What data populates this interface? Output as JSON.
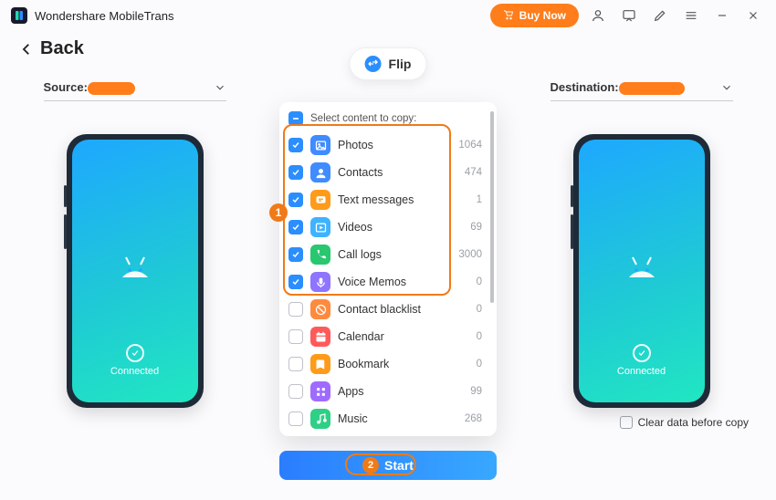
{
  "app": {
    "title": "Wondershare MobileTrans"
  },
  "titlebar": {
    "buy": "Buy Now"
  },
  "nav": {
    "back": "Back"
  },
  "flip": {
    "label": "Flip"
  },
  "source": {
    "label": "Source:"
  },
  "destination": {
    "label": "Destination:"
  },
  "phone": {
    "status": "Connected"
  },
  "panel": {
    "header": "Select content to copy:"
  },
  "items": [
    {
      "name": "Photos",
      "count": "1064",
      "checked": true,
      "iconBg": "#3f8bff",
      "glyph": "photo"
    },
    {
      "name": "Contacts",
      "count": "474",
      "checked": true,
      "iconBg": "#3f8bff",
      "glyph": "person"
    },
    {
      "name": "Text messages",
      "count": "1",
      "checked": true,
      "iconBg": "#ff9b1a",
      "glyph": "msg"
    },
    {
      "name": "Videos",
      "count": "69",
      "checked": true,
      "iconBg": "#3fb3ff",
      "glyph": "play"
    },
    {
      "name": "Call logs",
      "count": "3000",
      "checked": true,
      "iconBg": "#29c76f",
      "glyph": "phone"
    },
    {
      "name": "Voice Memos",
      "count": "0",
      "checked": true,
      "iconBg": "#8f74ff",
      "glyph": "mic"
    },
    {
      "name": "Contact blacklist",
      "count": "0",
      "checked": false,
      "iconBg": "#ff8a3d",
      "glyph": "block"
    },
    {
      "name": "Calendar",
      "count": "0",
      "checked": false,
      "iconBg": "#ff5a5a",
      "glyph": "cal"
    },
    {
      "name": "Bookmark",
      "count": "0",
      "checked": false,
      "iconBg": "#ff9b1a",
      "glyph": "book"
    },
    {
      "name": "Apps",
      "count": "99",
      "checked": false,
      "iconBg": "#9f6bff",
      "glyph": "grid"
    },
    {
      "name": "Music",
      "count": "268",
      "checked": false,
      "iconBg": "#2ecf86",
      "glyph": "music"
    }
  ],
  "start": {
    "label": "Start"
  },
  "clear": {
    "label": "Clear data before copy"
  },
  "steps": {
    "one": "1",
    "two": "2"
  }
}
